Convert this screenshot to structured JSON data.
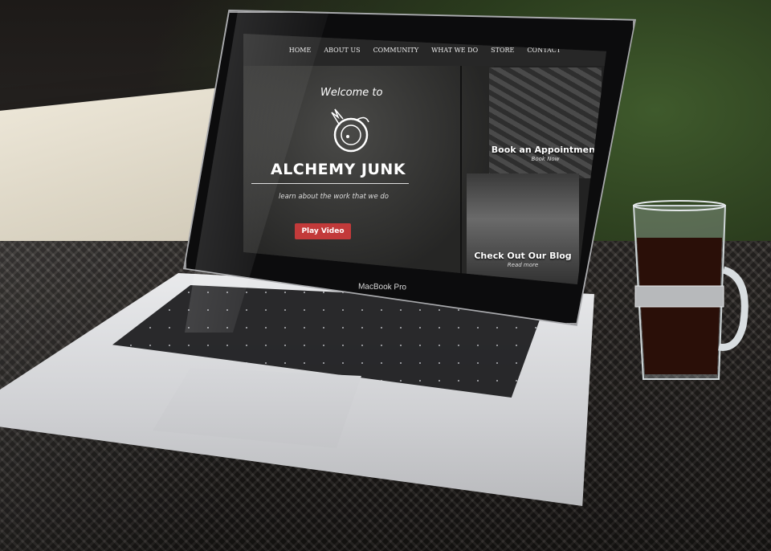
{
  "device": {
    "brand_label": "MacBook Pro"
  },
  "website": {
    "nav": [
      "HOME",
      "ABOUT US",
      "COMMUNITY",
      "WHAT WE DO",
      "STORE",
      "CONTACT"
    ],
    "hero": {
      "welcome": "Welcome to",
      "title": "ALCHEMY JUNK",
      "tagline": "learn about the work that we do",
      "button": "Play Video"
    },
    "tiles": [
      {
        "title": "Book an Appointment",
        "subtitle": "Book Now"
      },
      {
        "title": "Check Out Our Blog",
        "subtitle": "Read more"
      }
    ]
  },
  "colors": {
    "accent": "#c23a3a"
  }
}
